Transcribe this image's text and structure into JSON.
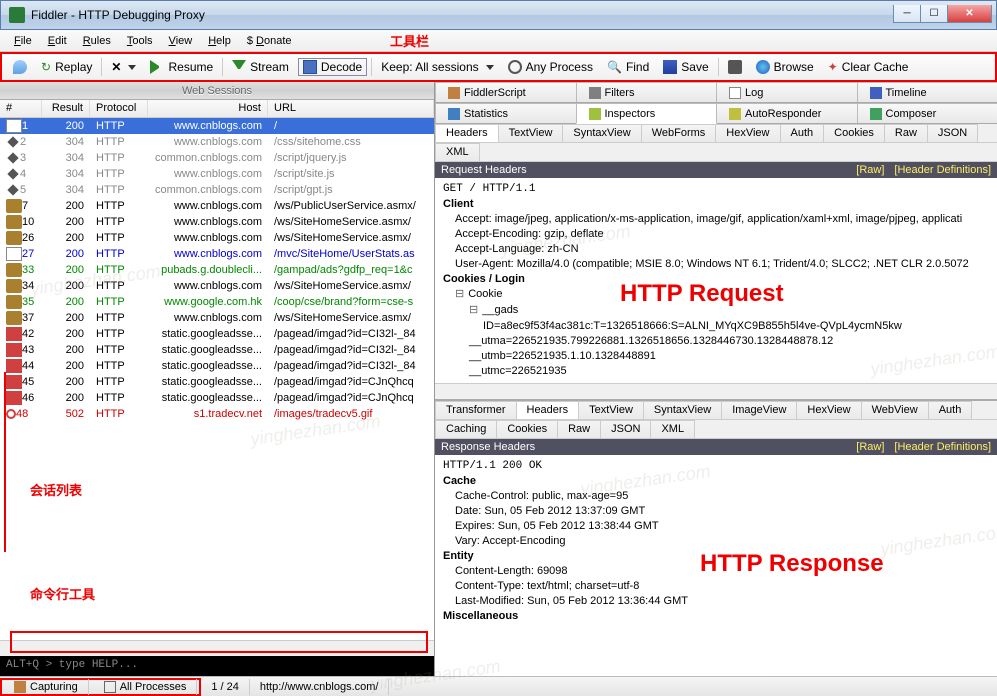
{
  "title": "Fiddler - HTTP Debugging Proxy",
  "menubar": [
    "File",
    "Edit",
    "Rules",
    "Tools",
    "View",
    "Help",
    "$ Donate"
  ],
  "toolbar": {
    "replay": "Replay",
    "resume": "Resume",
    "stream": "Stream",
    "decode": "Decode",
    "keep": "Keep: All sessions",
    "anyproc": "Any Process",
    "find": "Find",
    "save": "Save",
    "browse": "Browse",
    "clear": "Clear Cache"
  },
  "anno": {
    "toolbar": "工具栏",
    "sessions": "会话列表",
    "cmdline": "命令行工具",
    "request": "HTTP Request",
    "response": "HTTP Response"
  },
  "wsTitle": "Web Sessions",
  "columns": {
    "num": "#",
    "result": "Result",
    "protocol": "Protocol",
    "host": "Host",
    "url": "URL"
  },
  "sessions": [
    {
      "n": "1",
      "r": "200",
      "p": "HTTP",
      "h": "www.cnblogs.com",
      "u": "/",
      "sel": true,
      "c": "",
      "i": "doc"
    },
    {
      "n": "2",
      "r": "304",
      "p": "HTTP",
      "h": "www.cnblogs.com",
      "u": "/css/sitehome.css",
      "c": "gray",
      "i": "diamond"
    },
    {
      "n": "3",
      "r": "304",
      "p": "HTTP",
      "h": "common.cnblogs.com",
      "u": "/script/jquery.js",
      "c": "gray",
      "i": "diamond"
    },
    {
      "n": "4",
      "r": "304",
      "p": "HTTP",
      "h": "www.cnblogs.com",
      "u": "/script/site.js",
      "c": "gray",
      "i": "diamond"
    },
    {
      "n": "5",
      "r": "304",
      "p": "HTTP",
      "h": "common.cnblogs.com",
      "u": "/script/gpt.js",
      "c": "gray",
      "i": "diamond"
    },
    {
      "n": "7",
      "r": "200",
      "p": "HTTP",
      "h": "www.cnblogs.com",
      "u": "/ws/PublicUserService.asmx/",
      "c": "",
      "i": "js"
    },
    {
      "n": "10",
      "r": "200",
      "p": "HTTP",
      "h": "www.cnblogs.com",
      "u": "/ws/SiteHomeService.asmx/",
      "c": "",
      "i": "js"
    },
    {
      "n": "26",
      "r": "200",
      "p": "HTTP",
      "h": "www.cnblogs.com",
      "u": "/ws/SiteHomeService.asmx/",
      "c": "",
      "i": "js"
    },
    {
      "n": "27",
      "r": "200",
      "p": "HTTP",
      "h": "www.cnblogs.com",
      "u": "/mvc/SiteHome/UserStats.as",
      "c": "blue",
      "i": "doc"
    },
    {
      "n": "33",
      "r": "200",
      "p": "HTTP",
      "h": "pubads.g.doublecli...",
      "u": "/gampad/ads?gdfp_req=1&c",
      "c": "green",
      "i": "js"
    },
    {
      "n": "34",
      "r": "200",
      "p": "HTTP",
      "h": "www.cnblogs.com",
      "u": "/ws/SiteHomeService.asmx/",
      "c": "",
      "i": "js"
    },
    {
      "n": "35",
      "r": "200",
      "p": "HTTP",
      "h": "www.google.com.hk",
      "u": "/coop/cse/brand?form=cse-s",
      "c": "green",
      "i": "js"
    },
    {
      "n": "37",
      "r": "200",
      "p": "HTTP",
      "h": "www.cnblogs.com",
      "u": "/ws/SiteHomeService.asmx/",
      "c": "",
      "i": "js"
    },
    {
      "n": "42",
      "r": "200",
      "p": "HTTP",
      "h": "static.googleadsse...",
      "u": "/pagead/imgad?id=CI32l-_84",
      "c": "",
      "i": "red"
    },
    {
      "n": "43",
      "r": "200",
      "p": "HTTP",
      "h": "static.googleadsse...",
      "u": "/pagead/imgad?id=CI32l-_84",
      "c": "",
      "i": "red"
    },
    {
      "n": "44",
      "r": "200",
      "p": "HTTP",
      "h": "static.googleadsse...",
      "u": "/pagead/imgad?id=CI32l-_84",
      "c": "",
      "i": "red"
    },
    {
      "n": "45",
      "r": "200",
      "p": "HTTP",
      "h": "static.googleadsse...",
      "u": "/pagead/imgad?id=CJnQhcq",
      "c": "",
      "i": "red"
    },
    {
      "n": "46",
      "r": "200",
      "p": "HTTP",
      "h": "static.googleadsse...",
      "u": "/pagead/imgad?id=CJnQhcq",
      "c": "",
      "i": "red"
    },
    {
      "n": "48",
      "r": "502",
      "p": "HTTP",
      "h": "s1.tradecv.net",
      "u": "/images/tradecv5.gif",
      "c": "red",
      "i": "block"
    }
  ],
  "cmdPrompt": "ALT+Q > type HELP...",
  "tabsTop": [
    "Statistics",
    "FiddlerScript",
    "Inspectors",
    "Filters",
    "AutoResponder",
    "Log",
    "Composer",
    "Timeline"
  ],
  "reqTabs": [
    "Headers",
    "TextView",
    "SyntaxView",
    "WebForms",
    "HexView",
    "Auth",
    "Cookies",
    "Raw",
    "JSON",
    "XML"
  ],
  "respTabs1": [
    "Transformer",
    "Headers",
    "TextView",
    "SyntaxView",
    "ImageView",
    "HexView",
    "WebView",
    "Auth"
  ],
  "respTabs2": [
    "Caching",
    "Cookies",
    "Raw",
    "JSON",
    "XML"
  ],
  "reqHdrTitle": "Request Headers",
  "raw": "[Raw]",
  "hdrDef": "[Header Definitions]",
  "reqLine": "GET / HTTP/1.1",
  "client": "Client",
  "accept": "Accept: image/jpeg, application/x-ms-application, image/gif, application/xaml+xml, image/pjpeg, applicati",
  "acceptEnc": "Accept-Encoding: gzip, deflate",
  "acceptLang": "Accept-Language: zh-CN",
  "userAgent": "User-Agent: Mozilla/4.0 (compatible; MSIE 8.0; Windows NT 6.1; Trident/4.0; SLCC2; .NET CLR 2.0.5072",
  "cookiesLogin": "Cookies / Login",
  "cookie": "Cookie",
  "gads": "__gads",
  "gadsId": "ID=a8ec9f53f4ac381c:T=1326518666:S=ALNI_MYqXC9B855h5l4ve-QVpL4ycmN5kw",
  "utma": "__utma=226521935.799226881.1326518656.1328446730.1328448878.12",
  "utmb": "__utmb=226521935.1.10.1328448891",
  "utmc": "__utmc=226521935",
  "respHdrTitle": "Response Headers",
  "respLine": "HTTP/1.1 200 OK",
  "cache": "Cache",
  "cacheCtl": "Cache-Control: public, max-age=95",
  "date": "Date: Sun, 05 Feb 2012 13:37:09 GMT",
  "expires": "Expires: Sun, 05 Feb 2012 13:38:44 GMT",
  "vary": "Vary: Accept-Encoding",
  "entity": "Entity",
  "contLen": "Content-Length: 69098",
  "contType": "Content-Type: text/html; charset=utf-8",
  "lastMod": "Last-Modified: Sun, 05 Feb 2012 13:36:44 GMT",
  "misc": "Miscellaneous",
  "status": {
    "capturing": "Capturing",
    "allproc": "All Processes",
    "count": "1 / 24",
    "url": "http://www.cnblogs.com/"
  },
  "watermark": "yinghezhan.com"
}
